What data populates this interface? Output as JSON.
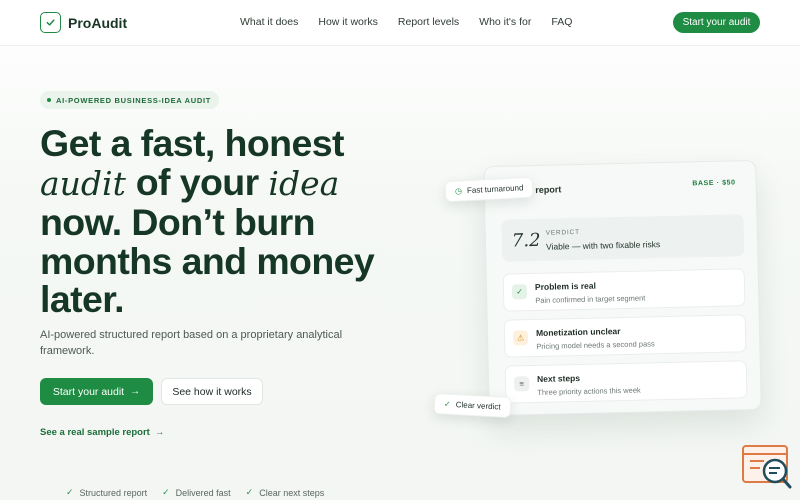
{
  "header": {
    "brand": "ProAudit",
    "nav": [
      "What it does",
      "How it works",
      "Report levels",
      "Who it's for",
      "FAQ"
    ],
    "cta_label": "Start your audit"
  },
  "hero": {
    "badge": "AI-POWERED BUSINESS-IDEA AUDIT",
    "headline": {
      "line1": "Get a fast, honest",
      "italic1": "audit",
      "mid": " of your ",
      "italic2": "idea",
      "line3": "now. Don’t burn",
      "line4": "months and money",
      "line5": "later."
    },
    "subtext": "AI-powered structured report based on a proprietary analytical framework.",
    "primary_button": "Start your audit",
    "secondary_button": "See how it works",
    "sample_link": "See a real sample report",
    "features": [
      "Structured report",
      "Delivered fast",
      "Clear next steps"
    ]
  },
  "report_card": {
    "title": "t report",
    "price": "BASE · $50",
    "verdict": {
      "score": "7.2",
      "label": "VERDICT",
      "text": "Viable — with two fixable risks"
    },
    "items": [
      {
        "title": "Problem is real",
        "sub": "Pain confirmed in target segment",
        "icon": "check-icon"
      },
      {
        "title": "Monetization unclear",
        "sub": "Pricing model needs a second pass",
        "icon": "warning-icon"
      },
      {
        "title": "Next steps",
        "sub": "Three priority actions this week",
        "icon": "list-icon"
      }
    ]
  },
  "pills": {
    "turnaround": "Fast turnaround",
    "clear": "Clear verdict"
  },
  "colors": {
    "brand_green": "#1e8c43",
    "headline": "#163626",
    "warning": "#d68a12"
  }
}
